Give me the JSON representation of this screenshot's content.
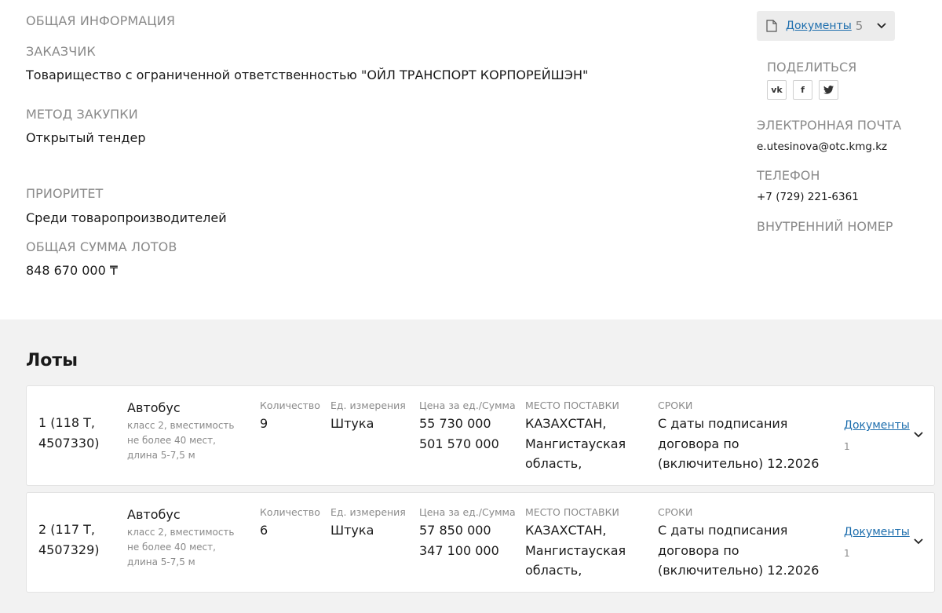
{
  "general": {
    "section_title": "ОБЩАЯ ИНФОРМАЦИЯ",
    "customer_label": "ЗАКАЗЧИК",
    "customer_value": "Товарищество с ограниченной ответственностью \"ОЙЛ ТРАНСПОРТ КОРПОРЕЙШЭН\"",
    "method_label": "МЕТОД ЗАКУПКИ",
    "method_value": "Открытый тендер",
    "priority_label": "ПРИОРИТЕТ",
    "priority_value": "Среди товаропроизводителей",
    "total_label": "ОБЩАЯ СУММА ЛОТОВ",
    "total_value": "848 670 000 ₸"
  },
  "sidebar": {
    "documents_label": "Документы",
    "documents_count": "5",
    "share_title": "ПОДЕЛИТЬСЯ",
    "socials": [
      "vk",
      "f",
      "t"
    ],
    "email_label": "ЭЛЕКТРОННАЯ ПОЧТА",
    "email_value": "e.utesinova@otc.kmg.kz",
    "phone_label": "ТЕЛЕФОН",
    "phone_value": "+7 (729) 221-6361",
    "internal_label": "ВНУТРЕННИЙ НОМЕР"
  },
  "lots": {
    "title": "Лоты",
    "columns": {
      "quantity": "Количество",
      "unit": "Ед. измерения",
      "price": "Цена за ед./Сумма",
      "place": "МЕСТО ПОСТАВКИ",
      "terms": "СРОКИ"
    },
    "items": [
      {
        "number": "1 (118 Т, 4507330)",
        "name": "Автобус",
        "description": "класс 2, вместимость не более 40 мест, длина 5-7,5 м",
        "quantity": "9",
        "unit": "Штука",
        "price": "55 730 000",
        "sum": "501 570 000",
        "place": "КАЗАХСТАН, Мангистауская область,",
        "terms": "С даты подписания договора по (включительно) 12.2026",
        "documents_label": "Документы",
        "documents_count": "1"
      },
      {
        "number": "2 (117 Т, 4507329)",
        "name": "Автобус",
        "description": "класс 2, вместимость не более 40 мест, длина 5-7,5 м",
        "quantity": "6",
        "unit": "Штука",
        "price": "57 850 000",
        "sum": "347 100 000",
        "place": "КАЗАХСТАН, Мангистауская область,",
        "terms": "С даты подписания договора по (включительно) 12.2026",
        "documents_label": "Документы",
        "documents_count": "1"
      }
    ]
  }
}
